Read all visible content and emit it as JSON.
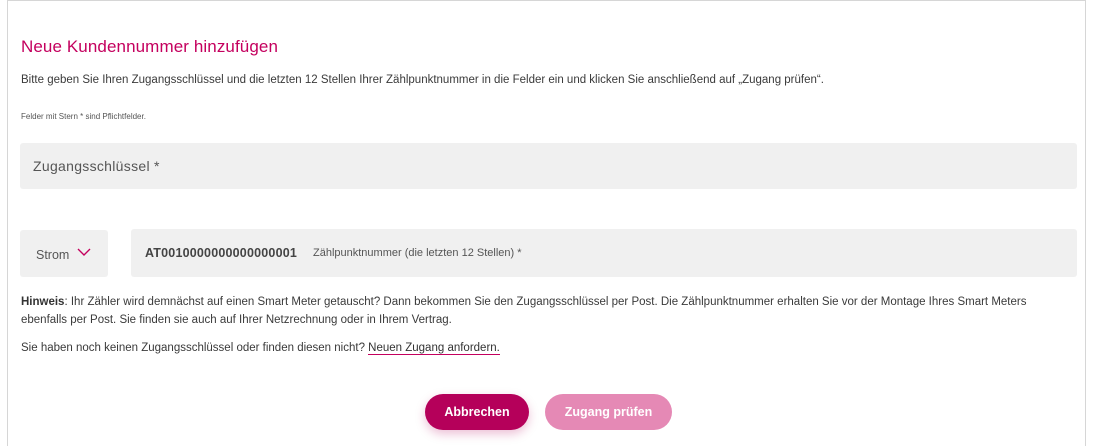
{
  "form": {
    "title": "Neue Kundennummer hinzufügen",
    "intro": "Bitte geben Sie Ihren Zugangsschlüssel und die letzten 12 Stellen Ihrer Zählpunktnummer in die Felder ein und klicken Sie anschließend auf „Zugang prüfen“.",
    "required_note": "Felder mit Stern * sind Pflichtfelder.",
    "access_key_placeholder": "Zugangsschlüssel *",
    "energy_type": {
      "selected": "Strom",
      "icon": "chevron-down-icon"
    },
    "meter_point": {
      "prefix": "AT0010000000000000001",
      "placeholder": "Zählpunktnummer (die letzten 12 Stellen) *"
    },
    "hint_label": "Hinweis",
    "hint_text": ": Ihr Zähler wird demnächst auf einen Smart Meter getauscht? Dann bekommen Sie den Zugangsschlüssel per Post. Die Zählpunktnummer erhalten Sie vor der Montage Ihres Smart Meters ebenfalls per Post. Sie finden sie auch auf Ihrer Netzrechnung oder in Ihrem Vertrag.",
    "no_key_text": "Sie haben noch keinen Zugangsschlüssel oder finden diesen nicht? ",
    "no_key_link": "Neuen Zugang anfordern.",
    "cancel_label": "Abbrechen",
    "check_label": "Zugang prüfen"
  },
  "colors": {
    "accent": "#c4005e",
    "primary_button": "#b5005a",
    "disabled_button": "#e589b5",
    "field_background": "#f0f0f0"
  }
}
